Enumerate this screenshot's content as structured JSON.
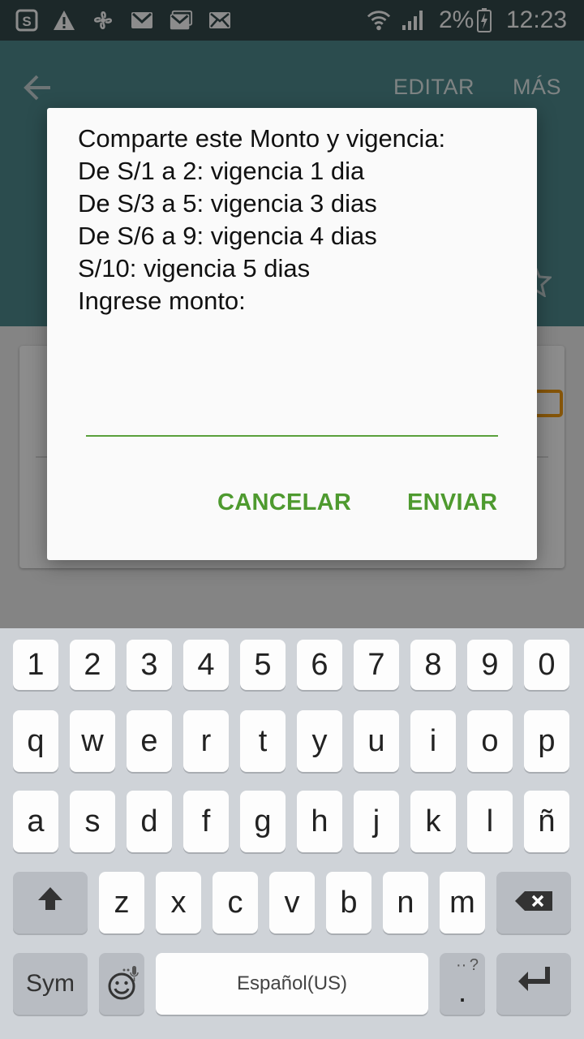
{
  "status_bar": {
    "icons": [
      "skype-icon",
      "warning-icon",
      "fan-icon",
      "gmail-icon",
      "gmail-stack-icon",
      "mail-icon",
      "wifi-icon",
      "signal-icon",
      "battery-charging-icon"
    ],
    "battery_text": "2%",
    "time": "12:23"
  },
  "app_bar": {
    "back_icon": "arrow-back-icon",
    "edit_label": "EDITAR",
    "more_label": "MÁS",
    "favorite_icon": "star-outline-icon"
  },
  "dialog": {
    "lines": [
      "Comparte este Monto y vigencia:",
      "De S/1 a 2: vigencia 1 dia",
      "De S/3 a 5: vigencia 3 dias",
      "De S/6 a 9: vigencia 4 dias",
      "S/10: vigencia 5 dias",
      "Ingrese monto:"
    ],
    "input_value": "",
    "cancel_label": "CANCELAR",
    "send_label": "ENVIAR"
  },
  "keyboard": {
    "row_numbers": [
      "1",
      "2",
      "3",
      "4",
      "5",
      "6",
      "7",
      "8",
      "9",
      "0"
    ],
    "row_1": [
      "q",
      "w",
      "e",
      "r",
      "t",
      "y",
      "u",
      "i",
      "o",
      "p"
    ],
    "row_2": [
      "a",
      "s",
      "d",
      "f",
      "g",
      "h",
      "j",
      "k",
      "l",
      "ñ"
    ],
    "row_3": [
      "z",
      "x",
      "c",
      "v",
      "b",
      "n",
      "m"
    ],
    "sym_label": "Sym",
    "space_label": "Español(US)",
    "period_label": ".",
    "period_sub": "?",
    "shift_icon": "shift-arrow-icon",
    "backspace_icon": "backspace-icon",
    "emoji_icon": "emoji-icon",
    "mic_icon": "microphone-icon",
    "enter_icon": "enter-icon"
  },
  "colors": {
    "status_bar": "#34494b",
    "app_bar": "#4f8a8f",
    "accent_green": "#4e9a2f",
    "keyboard_bg": "#cfd3d8"
  }
}
